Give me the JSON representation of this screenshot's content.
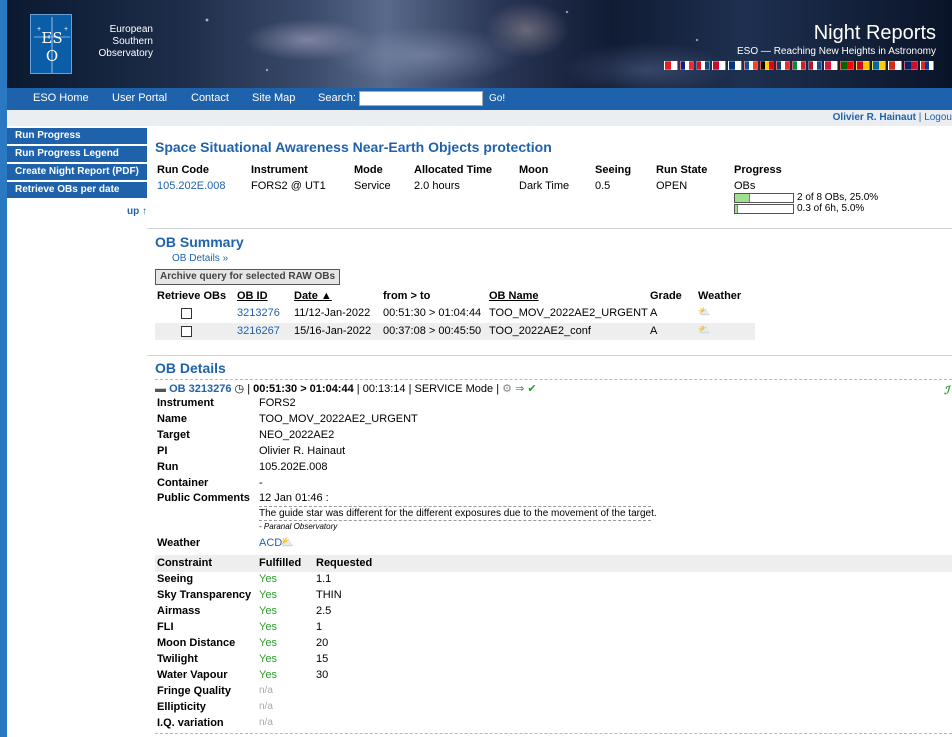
{
  "header": {
    "org_line1": "European",
    "org_line2": "Southern",
    "org_line3": "Observatory",
    "site_title": "Night Reports",
    "tagline": "ESO — Reaching New Heights in Astronomy",
    "flags": [
      "#e41f1f|#fff",
      "#002395|#fff|#ed2939",
      "#d7141a|#fff|#11457e",
      "#c60c30|#fff",
      "#003580|#fff",
      "#0055a4|#fff|#ef4135",
      "#000|#ffce00|#dd0000",
      "#0c4076|#fff|#ef2b2d",
      "#008c45|#fff|#cd212a",
      "#ae1c28|#fff|#21468b",
      "#dc143c|#fff",
      "#006600|#ff0000",
      "#c60b1e|#ffc400",
      "#006aa7|#fecc00",
      "#d52b1e|#fff",
      "#012169|#c8102e",
      "#d52b1e|#0039a6|#fff"
    ]
  },
  "topnav": {
    "items": [
      "ESO Home",
      "User Portal",
      "Contact",
      "Site Map"
    ],
    "search_label": "Search:",
    "search_value": "",
    "go_label": "Go!"
  },
  "user": {
    "name": "Olivier R. Hainaut",
    "sep": "|",
    "logout": "Logou"
  },
  "sidebar": {
    "items": [
      "Run Progress",
      "Run Progress Legend",
      "Create Night Report (PDF)",
      "Retrieve OBs per date"
    ],
    "up": "up ↑"
  },
  "run": {
    "title": "Space Situational Awareness Near-Earth Objects protection",
    "headers": {
      "code": "Run Code",
      "instrument": "Instrument",
      "mode": "Mode",
      "alloc": "Allocated Time",
      "moon": "Moon",
      "seeing": "Seeing",
      "state": "Run State",
      "progress": "Progress"
    },
    "code": "105.202E.008",
    "instrument": "FORS2 @ UT1",
    "mode": "Service",
    "alloc": "2.0 hours",
    "moon": "Dark Time",
    "seeing": "0.5",
    "state": "OPEN",
    "progress_label": "OBs",
    "bar1_fraction": 0.25,
    "bar1_text": "2 of 8 OBs, 25.0%",
    "bar2_fraction": 0.05,
    "bar2_text": "0.3 of 6h, 5.0%"
  },
  "ob_summary": {
    "title": "OB Summary",
    "details_link": "OB Details »",
    "archive_button": "Archive query for selected RAW OBs",
    "columns": {
      "retrieve": "Retrieve OBs",
      "obid": "OB ID",
      "date": "Date ▲",
      "fromto": "from > to",
      "name": "OB Name",
      "grade": "Grade",
      "weather": "Weather"
    },
    "rows": [
      {
        "obid": "3213276",
        "date": "11/12-Jan-2022",
        "fromto": "00:51:30 > 01:04:44",
        "name": "TOO_MOV_2022AE2_URGENT",
        "grade": "A",
        "weather": "⛅"
      },
      {
        "obid": "3216267",
        "date": "15/16-Jan-2022",
        "fromto": "00:37:08 > 00:45:50",
        "name": "TOO_2022AE2_conf",
        "grade": "A",
        "weather": "⛅"
      }
    ]
  },
  "ob_details": {
    "title": "OB Details",
    "ob_link": "OB 3213276",
    "time_range": "00:51:30 > 01:04:44",
    "line_rest": "| 00:13:14 | SERVICE Mode |",
    "status_tail": "⇒ ✔",
    "fields": [
      {
        "label": "Instrument",
        "value": "FORS2"
      },
      {
        "label": "Name",
        "value": "TOO_MOV_2022AE2_URGENT"
      },
      {
        "label": "Target",
        "value": "NEO_2022AE2"
      },
      {
        "label": "PI",
        "value": "Olivier R. Hainaut"
      },
      {
        "label": "Run",
        "value": "105.202E.008"
      },
      {
        "label": "Container",
        "value": "-"
      }
    ],
    "comments_label": "Public Comments",
    "comment_date": "12 Jan 01:46 :",
    "comment_text": "The guide star was different for the different exposures due to the movement of the target.",
    "comment_source": "- Paranal Observatory",
    "weather_label": "Weather",
    "weather_value": "ACD",
    "constraint_headers": {
      "constraint": "Constraint",
      "fulfilled": "Fulfilled",
      "requested": "Requested"
    },
    "constraints": [
      {
        "name": "Seeing",
        "fulfilled": "Yes",
        "requested": "1.1"
      },
      {
        "name": "Sky Transparency",
        "fulfilled": "Yes",
        "requested": "THIN"
      },
      {
        "name": "Airmass",
        "fulfilled": "Yes",
        "requested": "2.5"
      },
      {
        "name": "FLI",
        "fulfilled": "Yes",
        "requested": "1"
      },
      {
        "name": "Moon Distance",
        "fulfilled": "Yes",
        "requested": "20"
      },
      {
        "name": "Twilight",
        "fulfilled": "Yes",
        "requested": "15"
      },
      {
        "name": "Water Vapour",
        "fulfilled": "Yes",
        "requested": "30"
      },
      {
        "name": "Fringe Quality",
        "fulfilled": "n/a",
        "requested": ""
      },
      {
        "name": "Ellipticity",
        "fulfilled": "n/a",
        "requested": ""
      },
      {
        "name": "I.Q. variation",
        "fulfilled": "n/a",
        "requested": ""
      }
    ]
  }
}
